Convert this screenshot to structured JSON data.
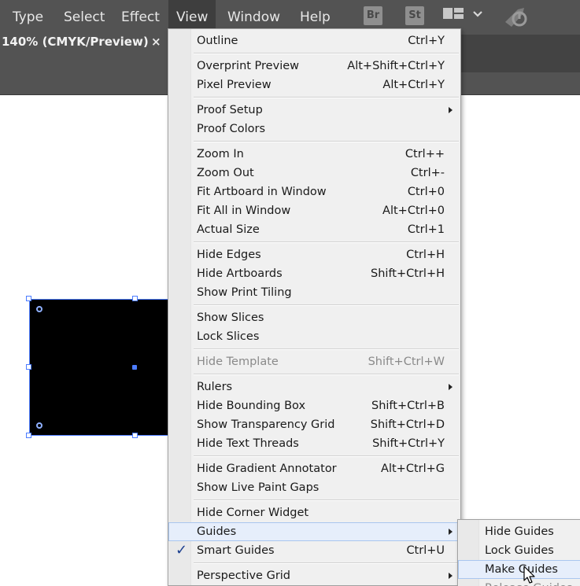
{
  "menubar": {
    "items": [
      {
        "id": "type",
        "label": "Type"
      },
      {
        "id": "select",
        "label": "Select"
      },
      {
        "id": "effect",
        "label": "Effect"
      },
      {
        "id": "view",
        "label": "View"
      },
      {
        "id": "window",
        "label": "Window"
      },
      {
        "id": "help",
        "label": "Help"
      }
    ],
    "bridge_icon": "Br",
    "stock_icon": "St"
  },
  "document_tab": {
    "title": "140% (CMYK/Preview)",
    "close_glyph": "×"
  },
  "view_menu": {
    "items": [
      {
        "label": "Outline",
        "shortcut": "Ctrl+Y"
      },
      {
        "label": "Overprint Preview",
        "shortcut": "Alt+Shift+Ctrl+Y"
      },
      {
        "label": "Pixel Preview",
        "shortcut": "Alt+Ctrl+Y"
      },
      {
        "label": "Proof Setup",
        "shortcut": ""
      },
      {
        "label": "Proof Colors",
        "shortcut": ""
      },
      {
        "label": "Zoom In",
        "shortcut": "Ctrl++"
      },
      {
        "label": "Zoom Out",
        "shortcut": "Ctrl+-"
      },
      {
        "label": "Fit Artboard in Window",
        "shortcut": "Ctrl+0"
      },
      {
        "label": "Fit All in Window",
        "shortcut": "Alt+Ctrl+0"
      },
      {
        "label": "Actual Size",
        "shortcut": "Ctrl+1"
      },
      {
        "label": "Hide Edges",
        "shortcut": "Ctrl+H"
      },
      {
        "label": "Hide Artboards",
        "shortcut": "Shift+Ctrl+H"
      },
      {
        "label": "Show Print Tiling",
        "shortcut": ""
      },
      {
        "label": "Show Slices",
        "shortcut": ""
      },
      {
        "label": "Lock Slices",
        "shortcut": ""
      },
      {
        "label": "Hide Template",
        "shortcut": "Shift+Ctrl+W"
      },
      {
        "label": "Rulers",
        "shortcut": ""
      },
      {
        "label": "Hide Bounding Box",
        "shortcut": "Shift+Ctrl+B"
      },
      {
        "label": "Show Transparency Grid",
        "shortcut": "Shift+Ctrl+D"
      },
      {
        "label": "Hide Text Threads",
        "shortcut": "Shift+Ctrl+Y"
      },
      {
        "label": "Hide Gradient Annotator",
        "shortcut": "Alt+Ctrl+G"
      },
      {
        "label": "Show Live Paint Gaps",
        "shortcut": ""
      },
      {
        "label": "Hide Corner Widget",
        "shortcut": ""
      },
      {
        "label": "Guides",
        "shortcut": ""
      },
      {
        "label": "Smart Guides",
        "shortcut": "Ctrl+U",
        "checked": "✓"
      },
      {
        "label": "Perspective Grid",
        "shortcut": ""
      }
    ]
  },
  "guides_submenu": {
    "items": [
      {
        "label": "Hide Guides"
      },
      {
        "label": "Lock Guides"
      },
      {
        "label": "Make Guides"
      },
      {
        "label": "Release Guides"
      }
    ]
  },
  "colors": {
    "menubar_bg": "#535353",
    "menu_bg": "#f0f0f0",
    "highlight": "#e6eefb",
    "selection_blue": "#4c7cff",
    "check_color": "#1b3f8f"
  }
}
